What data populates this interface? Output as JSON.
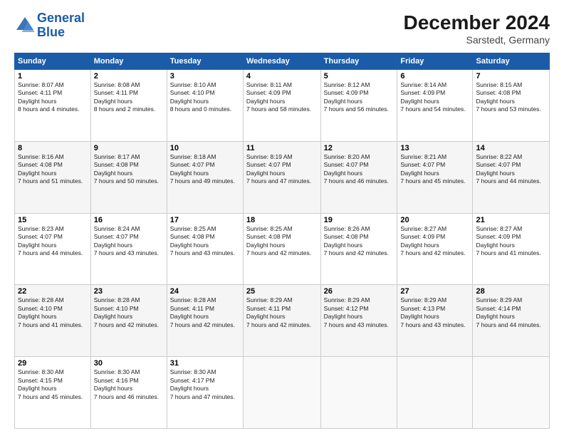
{
  "logo": {
    "line1": "General",
    "line2": "Blue"
  },
  "header": {
    "month": "December 2024",
    "location": "Sarstedt, Germany"
  },
  "weekdays": [
    "Sunday",
    "Monday",
    "Tuesday",
    "Wednesday",
    "Thursday",
    "Friday",
    "Saturday"
  ],
  "weeks": [
    [
      {
        "day": "1",
        "rise": "8:07 AM",
        "set": "4:11 PM",
        "daylight": "8 hours and 4 minutes."
      },
      {
        "day": "2",
        "rise": "8:08 AM",
        "set": "4:11 PM",
        "daylight": "8 hours and 2 minutes."
      },
      {
        "day": "3",
        "rise": "8:10 AM",
        "set": "4:10 PM",
        "daylight": "8 hours and 0 minutes."
      },
      {
        "day": "4",
        "rise": "8:11 AM",
        "set": "4:09 PM",
        "daylight": "7 hours and 58 minutes."
      },
      {
        "day": "5",
        "rise": "8:12 AM",
        "set": "4:09 PM",
        "daylight": "7 hours and 56 minutes."
      },
      {
        "day": "6",
        "rise": "8:14 AM",
        "set": "4:09 PM",
        "daylight": "7 hours and 54 minutes."
      },
      {
        "day": "7",
        "rise": "8:15 AM",
        "set": "4:08 PM",
        "daylight": "7 hours and 53 minutes."
      }
    ],
    [
      {
        "day": "8",
        "rise": "8:16 AM",
        "set": "4:08 PM",
        "daylight": "7 hours and 51 minutes."
      },
      {
        "day": "9",
        "rise": "8:17 AM",
        "set": "4:08 PM",
        "daylight": "7 hours and 50 minutes."
      },
      {
        "day": "10",
        "rise": "8:18 AM",
        "set": "4:07 PM",
        "daylight": "7 hours and 49 minutes."
      },
      {
        "day": "11",
        "rise": "8:19 AM",
        "set": "4:07 PM",
        "daylight": "7 hours and 47 minutes."
      },
      {
        "day": "12",
        "rise": "8:20 AM",
        "set": "4:07 PM",
        "daylight": "7 hours and 46 minutes."
      },
      {
        "day": "13",
        "rise": "8:21 AM",
        "set": "4:07 PM",
        "daylight": "7 hours and 45 minutes."
      },
      {
        "day": "14",
        "rise": "8:22 AM",
        "set": "4:07 PM",
        "daylight": "7 hours and 44 minutes."
      }
    ],
    [
      {
        "day": "15",
        "rise": "8:23 AM",
        "set": "4:07 PM",
        "daylight": "7 hours and 44 minutes."
      },
      {
        "day": "16",
        "rise": "8:24 AM",
        "set": "4:07 PM",
        "daylight": "7 hours and 43 minutes."
      },
      {
        "day": "17",
        "rise": "8:25 AM",
        "set": "4:08 PM",
        "daylight": "7 hours and 43 minutes."
      },
      {
        "day": "18",
        "rise": "8:25 AM",
        "set": "4:08 PM",
        "daylight": "7 hours and 42 minutes."
      },
      {
        "day": "19",
        "rise": "8:26 AM",
        "set": "4:08 PM",
        "daylight": "7 hours and 42 minutes."
      },
      {
        "day": "20",
        "rise": "8:27 AM",
        "set": "4:09 PM",
        "daylight": "7 hours and 42 minutes."
      },
      {
        "day": "21",
        "rise": "8:27 AM",
        "set": "4:09 PM",
        "daylight": "7 hours and 41 minutes."
      }
    ],
    [
      {
        "day": "22",
        "rise": "8:28 AM",
        "set": "4:10 PM",
        "daylight": "7 hours and 41 minutes."
      },
      {
        "day": "23",
        "rise": "8:28 AM",
        "set": "4:10 PM",
        "daylight": "7 hours and 42 minutes."
      },
      {
        "day": "24",
        "rise": "8:28 AM",
        "set": "4:11 PM",
        "daylight": "7 hours and 42 minutes."
      },
      {
        "day": "25",
        "rise": "8:29 AM",
        "set": "4:11 PM",
        "daylight": "7 hours and 42 minutes."
      },
      {
        "day": "26",
        "rise": "8:29 AM",
        "set": "4:12 PM",
        "daylight": "7 hours and 43 minutes."
      },
      {
        "day": "27",
        "rise": "8:29 AM",
        "set": "4:13 PM",
        "daylight": "7 hours and 43 minutes."
      },
      {
        "day": "28",
        "rise": "8:29 AM",
        "set": "4:14 PM",
        "daylight": "7 hours and 44 minutes."
      }
    ],
    [
      {
        "day": "29",
        "rise": "8:30 AM",
        "set": "4:15 PM",
        "daylight": "7 hours and 45 minutes."
      },
      {
        "day": "30",
        "rise": "8:30 AM",
        "set": "4:16 PM",
        "daylight": "7 hours and 46 minutes."
      },
      {
        "day": "31",
        "rise": "8:30 AM",
        "set": "4:17 PM",
        "daylight": "7 hours and 47 minutes."
      },
      null,
      null,
      null,
      null
    ]
  ]
}
